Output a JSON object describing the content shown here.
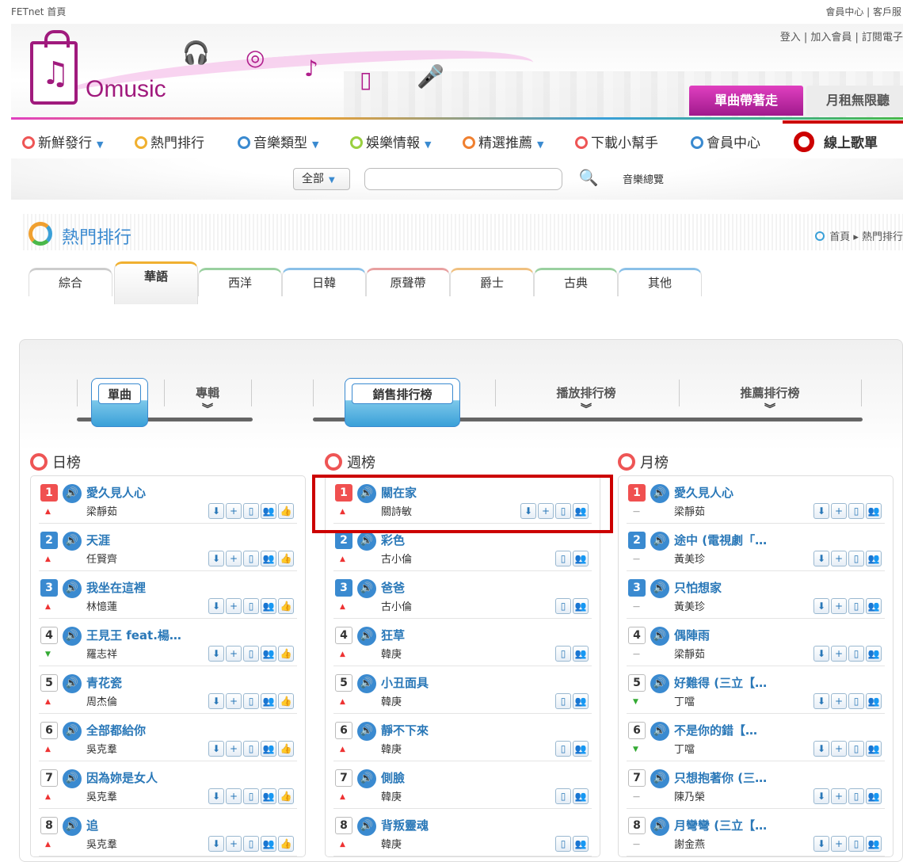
{
  "topbar": {
    "left": "FETnet 首頁",
    "right": "會員中心 | 客戶服"
  },
  "header": {
    "logo": "Omusic",
    "links": "登入 | 加入會員 | 訂閱電子",
    "tab_single": "單曲帶著走",
    "tab_monthly": "月租無限聽"
  },
  "nav": [
    {
      "label": "新鮮發行",
      "caret": "▼",
      "color": "#e55"
    },
    {
      "label": "熱門排行",
      "caret": "",
      "color": "#f0b030"
    },
    {
      "label": "音樂類型",
      "caret": "▼",
      "color": "#3a8ad0"
    },
    {
      "label": "娛樂情報",
      "caret": "▼",
      "color": "#9ad040"
    },
    {
      "label": "精選推薦",
      "caret": "▼",
      "color": "#f08030"
    },
    {
      "label": "下載小幫手",
      "caret": "",
      "color": "#e55"
    },
    {
      "label": "會員中心",
      "caret": "",
      "color": "#3a8ad0"
    },
    {
      "label": "線上歌單",
      "caret": "",
      "color": "#c00"
    }
  ],
  "search": {
    "select": "全部",
    "browse": "音樂總覽"
  },
  "page_title": "熱門排行",
  "breadcrumb": "首頁 ▸ 熱門排行",
  "genre_tabs": [
    "綜合",
    "華語",
    "西洋",
    "日韓",
    "原聲帶",
    "爵士",
    "古典",
    "其他"
  ],
  "type_tabs": {
    "single": "單曲",
    "album": "專輯"
  },
  "chart_tabs": {
    "sales": "銷售排行榜",
    "play": "播放排行榜",
    "recommend": "推薦排行榜"
  },
  "columns": [
    {
      "title": "日榜",
      "rows": [
        {
          "rank": "1",
          "song": "愛久見人心",
          "artist": "梁靜茹",
          "trend": "up"
        },
        {
          "rank": "2",
          "song": "天涯",
          "artist": "任賢齊",
          "trend": "up"
        },
        {
          "rank": "3",
          "song": "我坐在這裡",
          "artist": "林憶蓮",
          "trend": "up"
        },
        {
          "rank": "4",
          "song": "王見王 feat.楊…",
          "artist": "羅志祥",
          "trend": "dn"
        },
        {
          "rank": "5",
          "song": "青花瓷",
          "artist": "周杰倫",
          "trend": "up"
        },
        {
          "rank": "6",
          "song": "全部都給你",
          "artist": "吳克羣",
          "trend": "up"
        },
        {
          "rank": "7",
          "song": "因為妳是女人",
          "artist": "吳克羣",
          "trend": "up"
        },
        {
          "rank": "8",
          "song": "追",
          "artist": "吳克羣",
          "trend": "up"
        }
      ]
    },
    {
      "title": "週榜",
      "rows": [
        {
          "rank": "1",
          "song": "關在家",
          "artist": "關詩敏",
          "trend": "up"
        },
        {
          "rank": "2",
          "song": "彩色",
          "artist": "古小倫",
          "trend": "up"
        },
        {
          "rank": "3",
          "song": "爸爸",
          "artist": "古小倫",
          "trend": "up"
        },
        {
          "rank": "4",
          "song": "狂草",
          "artist": "韓庚",
          "trend": "up"
        },
        {
          "rank": "5",
          "song": "小丑面具",
          "artist": "韓庚",
          "trend": "up"
        },
        {
          "rank": "6",
          "song": "靜不下來",
          "artist": "韓庚",
          "trend": "up"
        },
        {
          "rank": "7",
          "song": "側臉",
          "artist": "韓庚",
          "trend": "up"
        },
        {
          "rank": "8",
          "song": "背叛靈魂",
          "artist": "韓庚",
          "trend": "up"
        }
      ]
    },
    {
      "title": "月榜",
      "rows": [
        {
          "rank": "1",
          "song": "愛久見人心",
          "artist": "梁靜茹",
          "trend": "eq"
        },
        {
          "rank": "2",
          "song": "途中 (電視劇「…",
          "artist": "黃美珍",
          "trend": "eq"
        },
        {
          "rank": "3",
          "song": "只怕想家",
          "artist": "黃美珍",
          "trend": "eq"
        },
        {
          "rank": "4",
          "song": "偶陣雨",
          "artist": "梁靜茹",
          "trend": "eq"
        },
        {
          "rank": "5",
          "song": "好難得 (三立【…",
          "artist": "丁噹",
          "trend": "dn"
        },
        {
          "rank": "6",
          "song": "不是你的錯【…",
          "artist": "丁噹",
          "trend": "dn"
        },
        {
          "rank": "7",
          "song": "只想抱著你 (三…",
          "artist": "陳乃榮",
          "trend": "eq"
        },
        {
          "rank": "8",
          "song": "月彎彎 (三立【…",
          "artist": "謝金燕",
          "trend": "eq"
        }
      ]
    }
  ]
}
